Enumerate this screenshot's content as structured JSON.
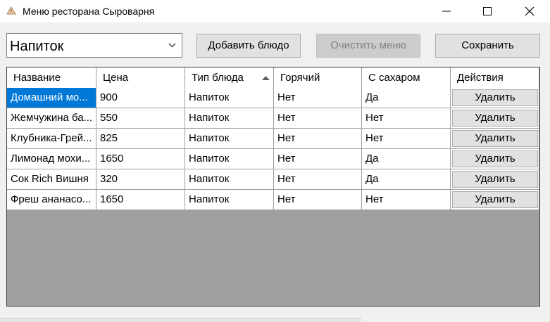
{
  "window": {
    "title": "Меню ресторана Сыроварня",
    "icon": "app-warning-icon"
  },
  "toolbar": {
    "category_selected": "Напиток",
    "add_label": "Добавить блюдо",
    "clear_label": "Очистить меню",
    "save_label": "Сохранить"
  },
  "grid": {
    "columns": [
      "Название",
      "Цена",
      "Тип блюда",
      "Горячий",
      "С сахаром",
      "Действия"
    ],
    "sorted_column": "Тип блюда",
    "rows": [
      {
        "name": "Домашний мо...",
        "price": "900",
        "type": "Напиток",
        "hot": "Нет",
        "sugar": "Да",
        "action": "Удалить"
      },
      {
        "name": "Жемчужина ба...",
        "price": "550",
        "type": "Напиток",
        "hot": "Нет",
        "sugar": "Нет",
        "action": "Удалить"
      },
      {
        "name": "Клубника-Грей...",
        "price": "825",
        "type": "Напиток",
        "hot": "Нет",
        "sugar": "Нет",
        "action": "Удалить"
      },
      {
        "name": "Лимонад мохи...",
        "price": "1650",
        "type": "Напиток",
        "hot": "Нет",
        "sugar": "Да",
        "action": "Удалить"
      },
      {
        "name": "Сок Rich Вишня",
        "price": "320",
        "type": "Напиток",
        "hot": "Нет",
        "sugar": "Да",
        "action": "Удалить"
      },
      {
        "name": "Фреш ананасо...",
        "price": "1650",
        "type": "Напиток",
        "hot": "Нет",
        "sugar": "Нет",
        "action": "Удалить"
      }
    ]
  },
  "colors": {
    "selection": "#0078d7",
    "grid_background": "#a0a0a0",
    "window_background": "#f0f0f0"
  }
}
